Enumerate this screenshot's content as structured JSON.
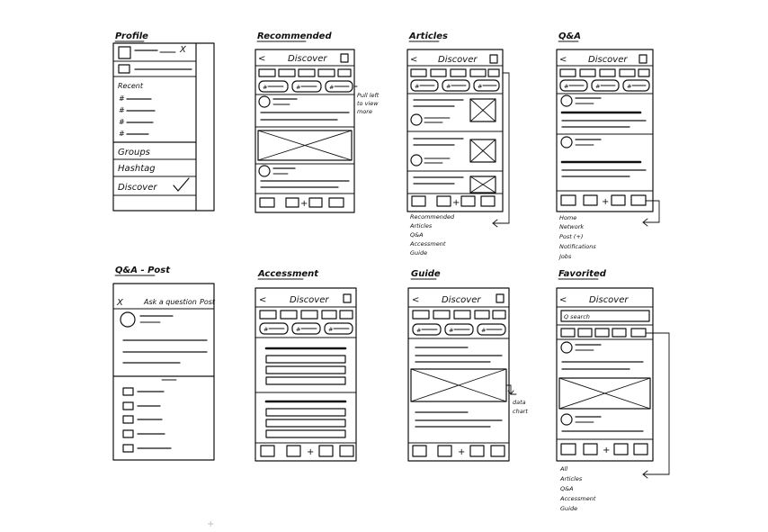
{
  "frames": {
    "profile": {
      "title": "Profile",
      "recent_label": "Recent",
      "hash_glyph": "#",
      "menu": [
        "Groups",
        "Hashtag",
        "Discover"
      ],
      "checked_item": "Discover"
    },
    "recommended": {
      "title": "Recommended",
      "header": "Discover",
      "chip_glyph": "#",
      "annotation": [
        "Pull left",
        "to view",
        "more"
      ]
    },
    "articles": {
      "title": "Articles",
      "header": "Discover",
      "chip_glyph": "#",
      "dropdown_options": [
        "Recommended",
        "Articles",
        "Q&A",
        "Accessment",
        "Guide"
      ]
    },
    "qa": {
      "title": "Q&A",
      "header": "Discover",
      "chip_glyph": "#",
      "tab_options": [
        "Home",
        "Network",
        "Post (+)",
        "Notifications",
        "Jobs"
      ]
    },
    "qa_post": {
      "title": "Q&A - Post",
      "close_glyph": "X",
      "header": "Ask a question",
      "post_label": "Post"
    },
    "accessment": {
      "title": "Accessment",
      "header": "Discover",
      "chip_glyph": "#"
    },
    "guide": {
      "title": "Guide",
      "header": "Discover",
      "chip_glyph": "#",
      "annotation": [
        "data",
        "chart"
      ]
    },
    "favorited": {
      "title": "Favorited",
      "header": "Discover",
      "search_placeholder": "Q search",
      "filter_options": [
        "All",
        "Articles",
        "Q&A",
        "Accessment",
        "Guide"
      ]
    }
  },
  "common": {
    "back_glyph": "<",
    "plus_glyph": "+",
    "check_glyph": "✓"
  },
  "colors": {
    "ink": "#111111",
    "paper": "#ffffff"
  },
  "icons": [
    "back-icon",
    "bookmark-icon",
    "plus-icon",
    "close-icon",
    "check-icon",
    "avatar-icon",
    "image-placeholder-icon",
    "arrow-icon"
  ]
}
